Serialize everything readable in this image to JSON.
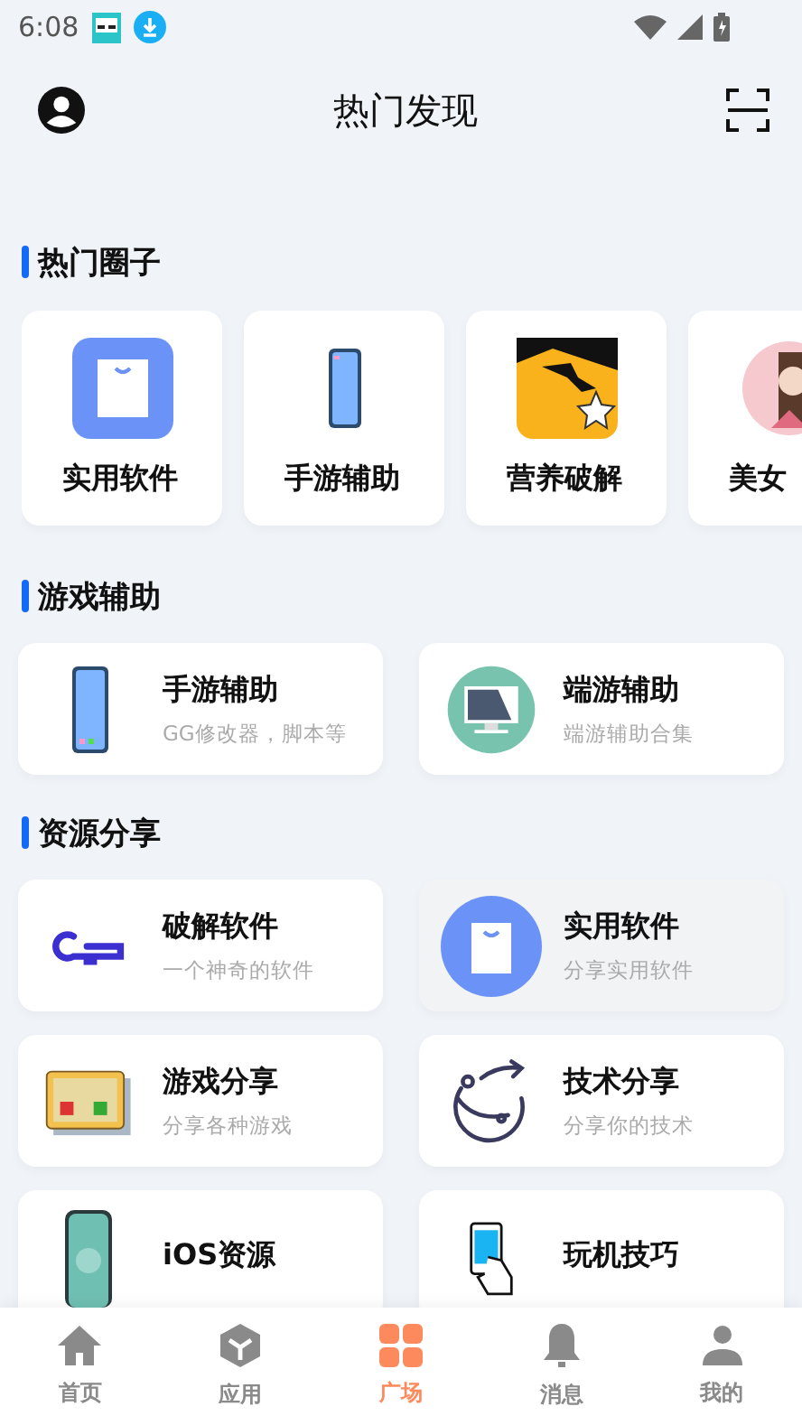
{
  "status_bar": {
    "time": "6:08"
  },
  "header": {
    "title": "热门发现"
  },
  "sections": [
    {
      "title": "热门圈子",
      "kind": "circles",
      "items": [
        {
          "label": "实用软件",
          "kind": "bag"
        },
        {
          "label": "手游辅助",
          "kind": "phone"
        },
        {
          "label": "营养破解",
          "kind": "star"
        },
        {
          "label": "美女",
          "kind": "picture"
        }
      ]
    },
    {
      "title": "游戏辅助",
      "kind": "grid",
      "items": [
        {
          "title": "手游辅助",
          "subtitle": "GG修改器，脚本等",
          "kind": "phone",
          "selected": false
        },
        {
          "title": "端游辅助",
          "subtitle": "端游辅助合集",
          "kind": "monitor",
          "selected": false
        }
      ]
    },
    {
      "title": "资源分享",
      "kind": "grid",
      "items": [
        {
          "title": "破解软件",
          "subtitle": "一个神奇的软件",
          "kind": "key",
          "selected": false
        },
        {
          "title": "实用软件",
          "subtitle": "分享实用软件",
          "kind": "bag",
          "selected": true
        },
        {
          "title": "游戏分享",
          "subtitle": "分享各种游戏",
          "kind": "cartridge",
          "selected": false
        },
        {
          "title": "技术分享",
          "subtitle": "分享你的技术",
          "kind": "planet",
          "selected": false
        },
        {
          "title": "iOS资源",
          "kind": "iphone",
          "selected": false
        },
        {
          "title": "玩机技巧",
          "kind": "handphone",
          "selected": false
        }
      ]
    }
  ],
  "tab_bar": [
    {
      "label": "首页",
      "selected": false
    },
    {
      "label": "应用",
      "selected": false
    },
    {
      "label": "广场",
      "selected": true
    },
    {
      "label": "消息",
      "selected": false
    },
    {
      "label": "我的",
      "selected": false
    }
  ]
}
